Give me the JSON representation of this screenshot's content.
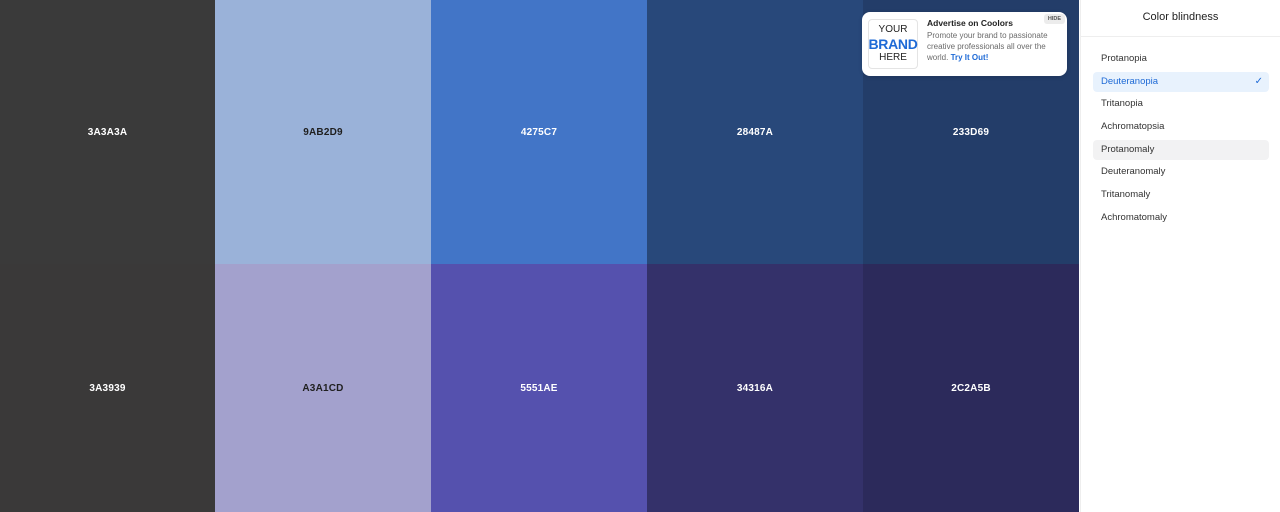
{
  "palette": {
    "top_row": [
      {
        "hex": "3A3A3A",
        "color": "#3A3A3A",
        "text_tone": "light"
      },
      {
        "hex": "9AB2D9",
        "color": "#9AB2D9",
        "text_tone": "dark"
      },
      {
        "hex": "4275C7",
        "color": "#4275C7",
        "text_tone": "light"
      },
      {
        "hex": "28487A",
        "color": "#28487A",
        "text_tone": "light"
      },
      {
        "hex": "233D69",
        "color": "#233D69",
        "text_tone": "light"
      }
    ],
    "bottom_row": [
      {
        "hex": "3A3939",
        "color": "#3A3939",
        "text_tone": "light"
      },
      {
        "hex": "A3A1CD",
        "color": "#A3A1CD",
        "text_tone": "dark"
      },
      {
        "hex": "5551AE",
        "color": "#5551AE",
        "text_tone": "light"
      },
      {
        "hex": "34316A",
        "color": "#34316A",
        "text_tone": "light"
      },
      {
        "hex": "2C2A5B",
        "color": "#2C2A5B",
        "text_tone": "light"
      }
    ]
  },
  "ad": {
    "logo_line1": "YOUR",
    "logo_line2": "BRAND",
    "logo_line3": "HERE",
    "title": "Advertise on Coolors",
    "body": "Promote your brand to passionate creative professionals all over the world.",
    "link": "Try It Out!",
    "hide_label": "HIDE"
  },
  "panel": {
    "title": "Color blindness",
    "options": [
      {
        "label": "Protanopia",
        "state": "normal"
      },
      {
        "label": "Deuteranopia",
        "state": "selected"
      },
      {
        "label": "Tritanopia",
        "state": "normal"
      },
      {
        "label": "Achromatopsia",
        "state": "normal"
      },
      {
        "label": "Protanomaly",
        "state": "hovered"
      },
      {
        "label": "Deuteranomaly",
        "state": "normal"
      },
      {
        "label": "Tritanomaly",
        "state": "normal"
      },
      {
        "label": "Achromatomaly",
        "state": "normal"
      }
    ],
    "check_icon": "checkmark-icon"
  },
  "colors": {
    "accent": "#1E6AD6",
    "selected_bg": "#E8F2FD",
    "hover_bg": "#F2F2F3"
  }
}
